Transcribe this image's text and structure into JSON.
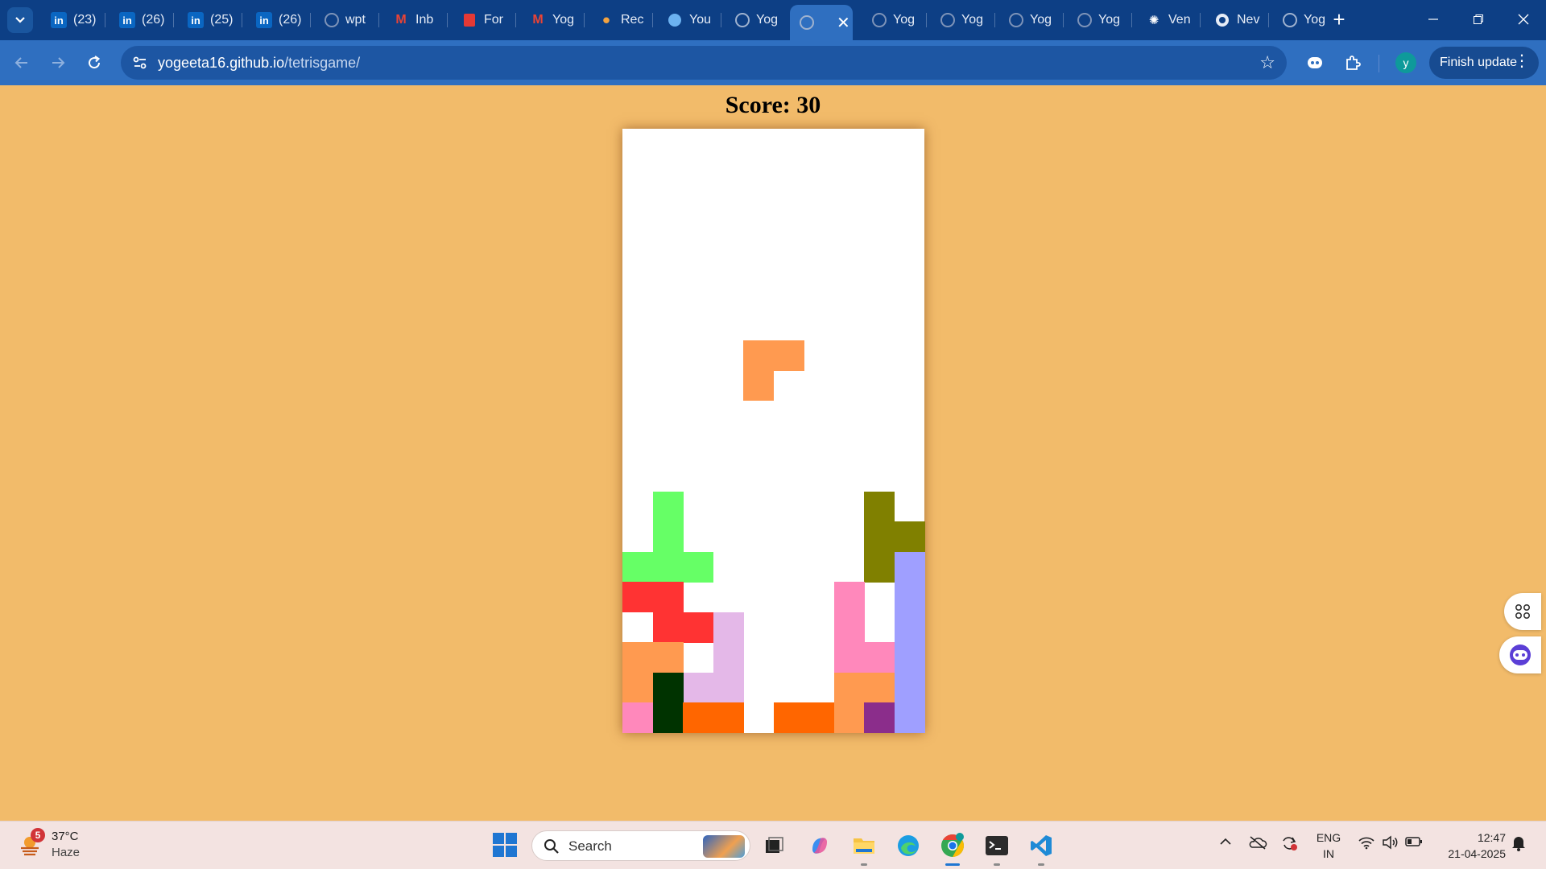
{
  "browser": {
    "tabs": [
      {
        "title": "(23)",
        "icon": "linkedin-icon"
      },
      {
        "title": "(26)",
        "icon": "linkedin-icon"
      },
      {
        "title": "(25)",
        "icon": "linkedin-icon"
      },
      {
        "title": "(26)",
        "icon": "linkedin-icon"
      },
      {
        "title": "wpt",
        "icon": "github-icon"
      },
      {
        "title": "Inb",
        "icon": "gmail-icon"
      },
      {
        "title": "For",
        "icon": "forms-icon"
      },
      {
        "title": "Yog",
        "icon": "gmail-icon"
      },
      {
        "title": "Rec",
        "icon": "recorder-icon"
      },
      {
        "title": "You",
        "icon": "app-icon"
      },
      {
        "title": "Yog",
        "icon": "globe-icon"
      },
      {
        "title": "",
        "icon": "globe-icon",
        "active": true
      },
      {
        "title": "Yog",
        "icon": "github-icon"
      },
      {
        "title": "Yog",
        "icon": "github-icon"
      },
      {
        "title": "Yog",
        "icon": "github-icon"
      },
      {
        "title": "Yog",
        "icon": "github-icon"
      },
      {
        "title": "Ven",
        "icon": "chatgpt-icon"
      },
      {
        "title": "Nev",
        "icon": "chrome-icon"
      },
      {
        "title": "Yog",
        "icon": "globe-icon"
      }
    ],
    "url_host": "yogeeta16.github.io",
    "url_path": "/tetrisgame/",
    "avatar_letter": "y",
    "finish_update_label": "Finish update",
    "accent": "#2f6fc0"
  },
  "game": {
    "score_text": "Score: 30",
    "background": "#f2bb6a",
    "board_columns": 10,
    "board_rows": 20,
    "falling_piece": {
      "color": "#ff9a50",
      "cells": [
        [
          4,
          7
        ],
        [
          5,
          7
        ],
        [
          4,
          8
        ]
      ]
    },
    "locked_cells": [
      {
        "c": 1,
        "r": 12,
        "color": "#66ff66"
      },
      {
        "c": 1,
        "r": 13,
        "color": "#66ff66"
      },
      {
        "c": 0,
        "r": 14,
        "color": "#66ff66"
      },
      {
        "c": 1,
        "r": 14,
        "color": "#66ff66"
      },
      {
        "c": 2,
        "r": 14,
        "color": "#66ff66"
      },
      {
        "c": 8,
        "r": 12,
        "color": "#808000"
      },
      {
        "c": 8,
        "r": 13,
        "color": "#808000"
      },
      {
        "c": 9,
        "r": 13,
        "color": "#808000"
      },
      {
        "c": 8,
        "r": 14,
        "color": "#808000"
      },
      {
        "c": 9,
        "r": 14,
        "color": "#9f9fff"
      },
      {
        "c": 9,
        "r": 15,
        "color": "#9f9fff"
      },
      {
        "c": 9,
        "r": 16,
        "color": "#9f9fff"
      },
      {
        "c": 9,
        "r": 17,
        "color": "#9f9fff"
      },
      {
        "c": 9,
        "r": 18,
        "color": "#9f9fff"
      },
      {
        "c": 9,
        "r": 19,
        "color": "#9f9fff"
      },
      {
        "c": 0,
        "r": 15,
        "color": "#ff3333"
      },
      {
        "c": 1,
        "r": 15,
        "color": "#ff3333"
      },
      {
        "c": 1,
        "r": 16,
        "color": "#ff3333"
      },
      {
        "c": 2,
        "r": 16,
        "color": "#ff3333"
      },
      {
        "c": 3,
        "r": 16,
        "color": "#e4b8e8"
      },
      {
        "c": 3,
        "r": 17,
        "color": "#e4b8e8"
      },
      {
        "c": 2,
        "r": 18,
        "color": "#e4b8e8"
      },
      {
        "c": 3,
        "r": 18,
        "color": "#e4b8e8"
      },
      {
        "c": 0,
        "r": 17,
        "color": "#ff9a50"
      },
      {
        "c": 1,
        "r": 17,
        "color": "#ff9a50"
      },
      {
        "c": 0,
        "r": 18,
        "color": "#ff9a50"
      },
      {
        "c": 0,
        "r": 19,
        "color": "#ff88bb"
      },
      {
        "c": 1,
        "r": 18,
        "color": "#003300"
      },
      {
        "c": 1,
        "r": 19,
        "color": "#003300"
      },
      {
        "c": 2,
        "r": 19,
        "color": "#ff6600"
      },
      {
        "c": 3,
        "r": 19,
        "color": "#ff6600"
      },
      {
        "c": 5,
        "r": 19,
        "color": "#ff6600"
      },
      {
        "c": 6,
        "r": 19,
        "color": "#ff6600"
      },
      {
        "c": 7,
        "r": 15,
        "color": "#ff88bb"
      },
      {
        "c": 7,
        "r": 16,
        "color": "#ff88bb"
      },
      {
        "c": 7,
        "r": 17,
        "color": "#ff88bb"
      },
      {
        "c": 8,
        "r": 17,
        "color": "#ff88bb"
      },
      {
        "c": 7,
        "r": 18,
        "color": "#ff9a50"
      },
      {
        "c": 8,
        "r": 18,
        "color": "#ff9a50"
      },
      {
        "c": 7,
        "r": 19,
        "color": "#ff9a50"
      },
      {
        "c": 8,
        "r": 19,
        "color": "#8b2d8b"
      }
    ]
  },
  "taskbar": {
    "weather_temp": "37°C",
    "weather_condition": "Haze",
    "weather_badge": "5",
    "search_label": "Search",
    "language_line1": "ENG",
    "language_line2": "IN",
    "time": "12:47",
    "date": "21-04-2025"
  }
}
